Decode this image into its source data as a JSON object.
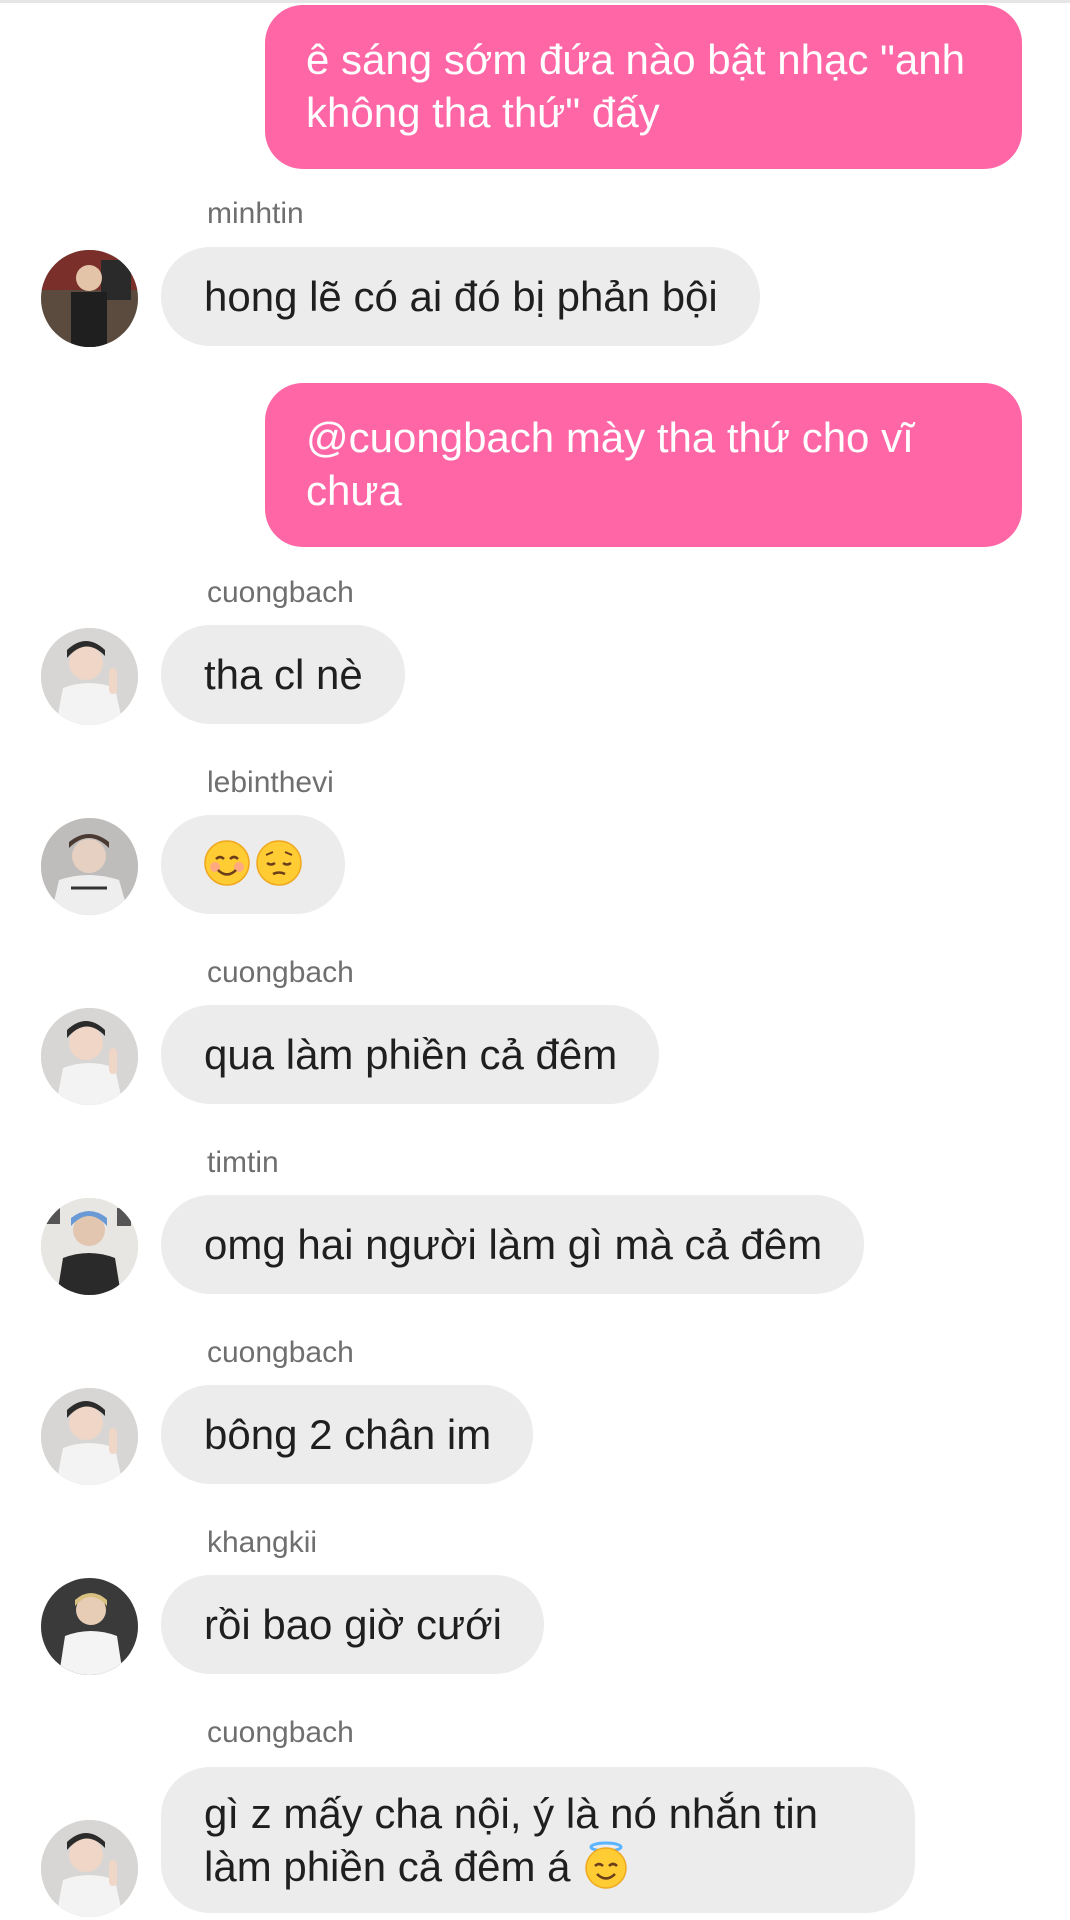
{
  "messages": {
    "m1": {
      "text": "ê sáng sớm đứa nào bật nhạc \"anh không tha thứ\" đấy"
    },
    "m2": {
      "sender": "minhtin",
      "text": "hong lẽ có ai đó bị phản bội"
    },
    "m3": {
      "text": "@cuongbach mày tha thứ cho vĩ chưa"
    },
    "m4": {
      "sender": "cuongbach",
      "text": "tha cl nè"
    },
    "m5": {
      "sender": "lebinthevi",
      "emojis": [
        "smiling-face-icon",
        "pensive-face-icon"
      ]
    },
    "m6": {
      "sender": "cuongbach",
      "text": "qua làm phiền cả đêm"
    },
    "m7": {
      "sender": "timtin",
      "text": "omg hai người làm gì mà cả đêm"
    },
    "m8": {
      "sender": "cuongbach",
      "text": "bông 2 chân im"
    },
    "m9": {
      "sender": "khangkii",
      "text": "rồi bao giờ cưới"
    },
    "m10": {
      "sender": "cuongbach",
      "text": "gì z mấy cha nội, ý là nó nhắn tin làm phiền cả đêm á",
      "emoji": "smiling-face-with-halo-icon"
    }
  },
  "colors": {
    "outgoing_bubble": "#ff66a6",
    "incoming_bubble": "#ececec",
    "sender_name": "#6f6f6f"
  }
}
